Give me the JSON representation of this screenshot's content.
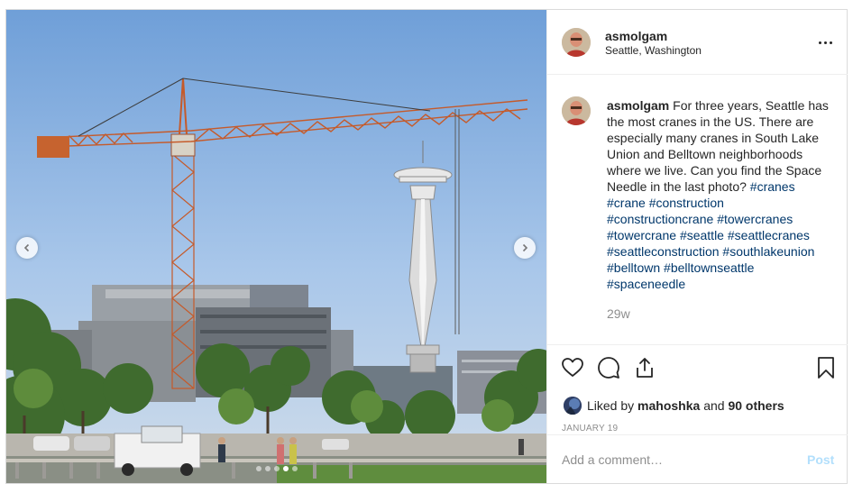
{
  "post": {
    "username": "asmolgam",
    "location": "Seattle, Washington",
    "more_icon": "more-horizontal-icon",
    "photo": {
      "slide_count": 5,
      "active_slide": 4,
      "prev_icon": "chevron-left-icon",
      "next_icon": "chevron-right-icon"
    },
    "caption": {
      "username": "asmolgam",
      "text": "For three years, Seattle has the most cranes in the US. There are especially many cranes in South Lake Union and Belltown neighborhoods where we live. Can you find the Space Needle in the last photo?",
      "hashtags": [
        "#cranes",
        "#crane",
        "#construction",
        "#constructioncrane",
        "#towercranes",
        "#towercrane",
        "#seattle",
        "#seattlecranes",
        "#seattleconstruction",
        "#southlakeunion",
        "#belltown",
        "#belltownseattle",
        "#spaceneedle"
      ]
    },
    "time_ago": "29w",
    "actions": {
      "like_icon": "heart-icon",
      "comment_icon": "comment-icon",
      "share_icon": "share-icon",
      "save_icon": "bookmark-icon"
    },
    "likes": {
      "prefix": "Liked by",
      "user": "mahoshka",
      "suffix": "and",
      "others": "90 others"
    },
    "date": "JANUARY 19",
    "comment": {
      "placeholder": "Add a comment…",
      "post_label": "Post"
    },
    "colors": {
      "hashtag": "#00376b",
      "post_button": "#b2dffc",
      "muted": "#8e8e8e"
    }
  }
}
